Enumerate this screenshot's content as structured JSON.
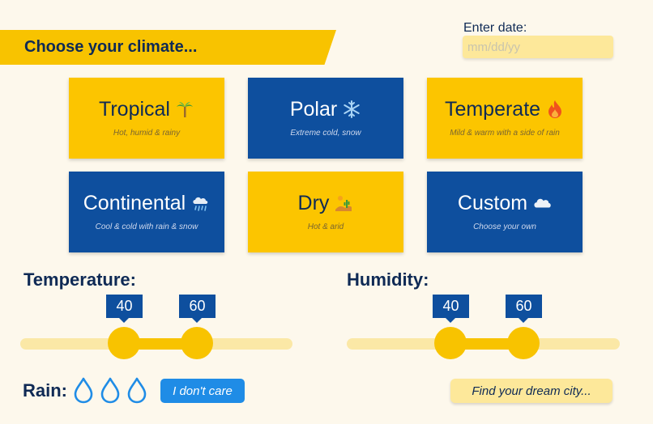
{
  "header": {
    "title": "Choose your climate..."
  },
  "date": {
    "label": "Enter date:",
    "placeholder": "mm/dd/yy",
    "value": ""
  },
  "climates": [
    {
      "title": "Tropical",
      "subtitle": "Hot, humid & rainy",
      "icon": "palm-tree-icon"
    },
    {
      "title": "Polar",
      "subtitle": "Extreme cold, snow",
      "icon": "snowflake-icon"
    },
    {
      "title": "Temperate",
      "subtitle": "Mild & warm with a side of rain",
      "icon": "fire-icon"
    },
    {
      "title": "Continental",
      "subtitle": "Cool & cold with rain & snow",
      "icon": "cloud-rain-icon"
    },
    {
      "title": "Dry",
      "subtitle": "Hot & arid",
      "icon": "desert-icon"
    },
    {
      "title": "Custom",
      "subtitle": "Choose your own",
      "icon": "cloud-icon"
    }
  ],
  "temperature": {
    "label": "Temperature:",
    "low": "40",
    "high": "60",
    "low_fraction": 0.38,
    "high_fraction": 0.65
  },
  "humidity": {
    "label": "Humidity:",
    "low": "40",
    "high": "60",
    "low_fraction": 0.38,
    "high_fraction": 0.65
  },
  "rain": {
    "label": "Rain:",
    "drops": 3,
    "dont_care_label": "I don't care"
  },
  "find_button": {
    "label": "Find your dream city..."
  },
  "colors": {
    "yellow": "#f8c300",
    "blue": "#0e4f9e",
    "light_yellow": "#fde89a",
    "background": "#fdf8ec",
    "drop_blue": "#1f8ce6"
  }
}
